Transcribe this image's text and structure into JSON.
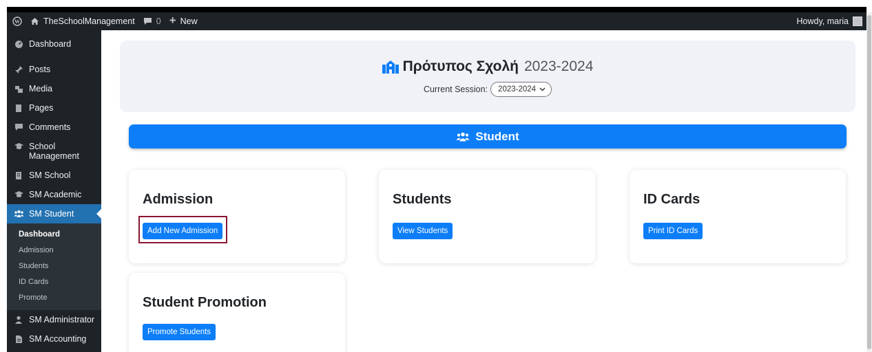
{
  "admin_bar": {
    "site_name": "TheSchoolManagement",
    "comments_count": "0",
    "new_label": "New",
    "greeting": "Howdy, maria"
  },
  "sidebar": {
    "items": [
      {
        "label": "Dashboard",
        "icon": "dashboard-icon"
      },
      {
        "label": "Posts",
        "icon": "pin-icon"
      },
      {
        "label": "Media",
        "icon": "media-icon"
      },
      {
        "label": "Pages",
        "icon": "pages-icon"
      },
      {
        "label": "Comments",
        "icon": "comment-icon"
      },
      {
        "label": "School Management",
        "icon": "graduation-cap-icon"
      },
      {
        "label": "SM School",
        "icon": "building-icon"
      },
      {
        "label": "SM Academic",
        "icon": "graduation-cap-icon"
      },
      {
        "label": "SM Student",
        "icon": "users-icon"
      },
      {
        "label": "SM Administrator",
        "icon": "user-tie-icon"
      },
      {
        "label": "SM Accounting",
        "icon": "invoice-icon"
      }
    ],
    "submenu": [
      "Dashboard",
      "Admission",
      "Students",
      "ID Cards",
      "Promote"
    ]
  },
  "header": {
    "school_name": "Πρότυπος Σχολή",
    "year": "2023-2024",
    "session_label": "Current Session:",
    "session_value": "2023-2024"
  },
  "section": {
    "title": "Student"
  },
  "cards": [
    {
      "title": "Admission",
      "button": "Add New Admission"
    },
    {
      "title": "Students",
      "button": "View Students"
    },
    {
      "title": "ID Cards",
      "button": "Print ID Cards"
    },
    {
      "title": "Student Promotion",
      "button": "Promote Students"
    }
  ],
  "colors": {
    "admin_bg": "#1d2327",
    "active_menu": "#2271b1",
    "primary": "#0d7ef7",
    "highlight_border": "#8a1530"
  }
}
